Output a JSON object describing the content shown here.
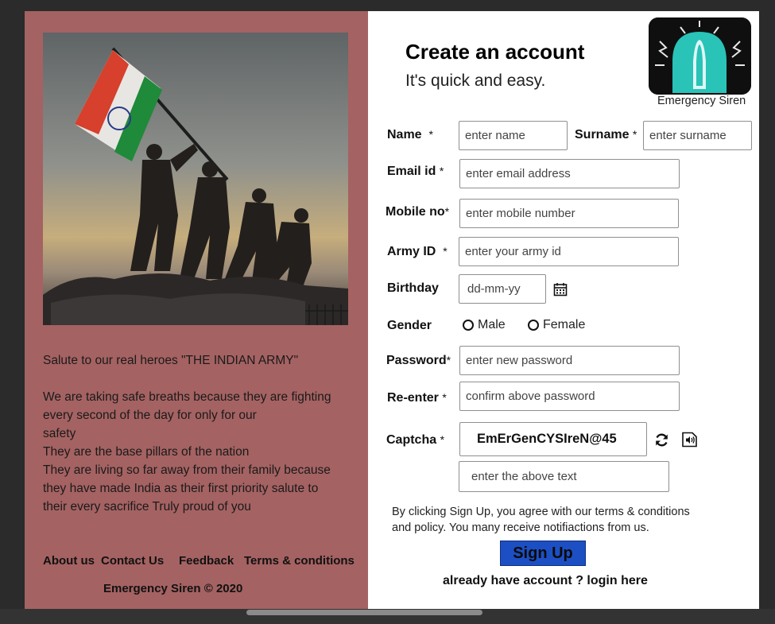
{
  "left": {
    "salute": "Salute to our real heroes \"THE INDIAN ARMY\"",
    "paragraph": "We are taking safe breaths because they are fighting\nevery second of the day for only for our\nsafety\nThey are the base pillars of the nation\nThey are living so far away from their family because\nthey have made India as their first priority salute to\ntheir every sacrifice Truly proud of you",
    "footer": {
      "about": "About us",
      "contact": "Contact Us",
      "feedback": "Feedback",
      "terms": "Terms & conditions",
      "copyright": "Emergency Siren © 2020"
    }
  },
  "form": {
    "title": "Create an account",
    "subtitle": "It's quick and easy.",
    "logo_caption": "Emergency Siren",
    "labels": {
      "name": "Name",
      "surname": "Surname",
      "email": "Email id",
      "mobile": "Mobile no",
      "army": "Army ID",
      "birthday": "Birthday",
      "gender": "Gender",
      "password": "Password",
      "reenter": "Re-enter",
      "captcha": "Captcha",
      "required": "*"
    },
    "placeholders": {
      "name": "enter name",
      "surname": "enter surname",
      "email": "enter email address",
      "mobile": "enter mobile number",
      "army": "enter your army id",
      "birthday": "dd-mm-yy",
      "password": "enter new password",
      "reenter": "confirm above password",
      "captcha_input": "enter the above text"
    },
    "gender_options": {
      "male": "Male",
      "female": "Female"
    },
    "captcha_text": "EmErGenCYSIreN@45",
    "terms": "By clicking Sign Up, you agree with our terms & conditions\nand policy. You many receive notifiactions from us.",
    "signup": "Sign Up",
    "login": "already have account ? login here"
  },
  "colors": {
    "left_panel": "#a56262",
    "signup_button": "#1d4fc4",
    "logo_teal": "#29c3b8"
  }
}
